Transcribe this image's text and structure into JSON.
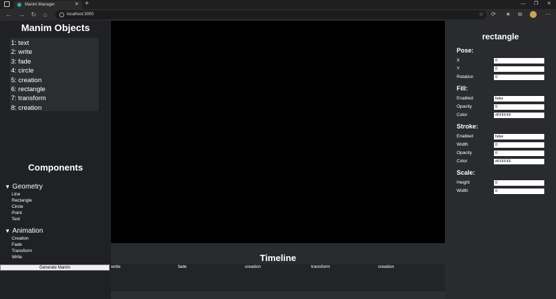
{
  "browser": {
    "tab_title": "Manim Manager",
    "url": "localhost:3000"
  },
  "objects": {
    "title": "Manim Objects",
    "items": [
      "1: text",
      "2: write",
      "3: fade",
      "4: circle",
      "5: creation",
      "6: rectangle",
      "7: transform",
      "8: creation"
    ]
  },
  "components": {
    "title": "Components",
    "geometry": {
      "label": "Geometry",
      "items": [
        "Line",
        "Rectangle",
        "Circle",
        "Point",
        "Text"
      ]
    },
    "animation": {
      "label": "Animation",
      "items": [
        "Creation",
        "Fade",
        "Transform",
        "Write"
      ]
    },
    "generate_label": "Generate Manim"
  },
  "timeline": {
    "title": "Timeline",
    "items": [
      "write",
      "fade",
      "creation",
      "transform",
      "creation"
    ]
  },
  "properties": {
    "title": "rectangle",
    "pose": {
      "label": "Pose:",
      "x_label": "X",
      "x": "0",
      "y_label": "Y",
      "y": "0",
      "rotation_label": "Rotation",
      "rotation": "0"
    },
    "fill": {
      "label": "Fill:",
      "enabled_label": "Enabled",
      "enabled": "false",
      "opacity_label": "Opacity",
      "opacity": "0",
      "color_label": "Color",
      "color": "#FFFFFF"
    },
    "stroke": {
      "label": "Stroke:",
      "enabled_label": "Enabled",
      "enabled": "false",
      "width_label": "Width",
      "width": "0",
      "opacity_label": "Opacity",
      "opacity": "0",
      "color_label": "Color",
      "color": "#FFFFFF"
    },
    "scale": {
      "label": "Scale:",
      "height_label": "Height",
      "height": "0",
      "width_label": "Width",
      "width": "0"
    }
  }
}
